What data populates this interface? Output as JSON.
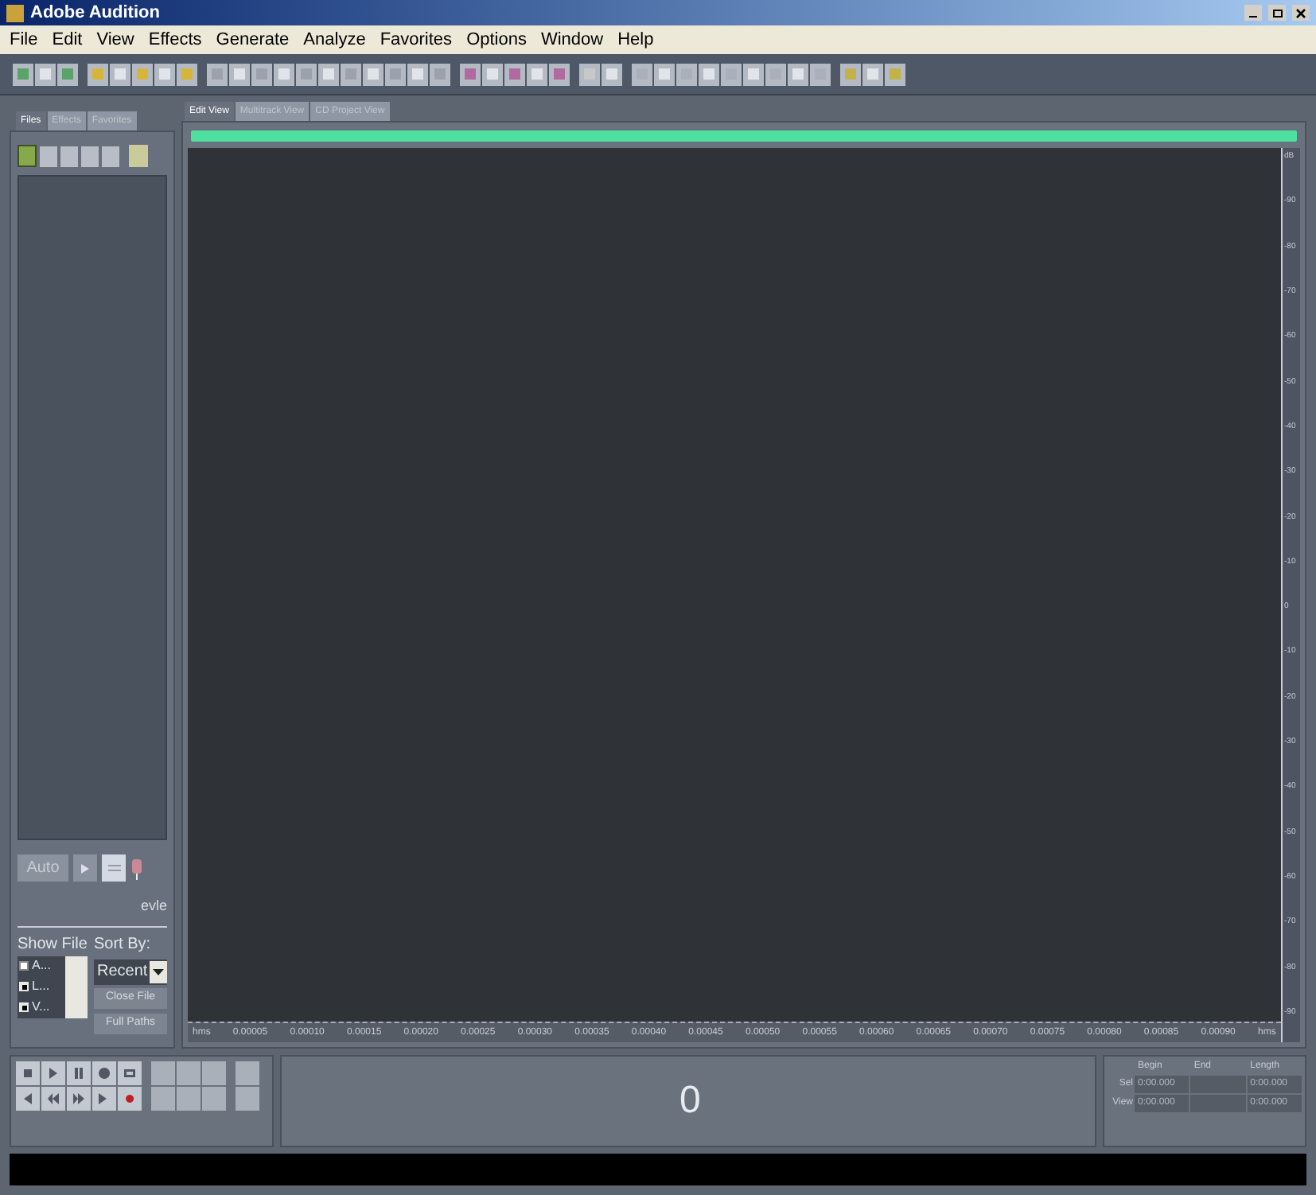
{
  "window": {
    "title": "Adobe Audition"
  },
  "menu": [
    "File",
    "Edit",
    "View",
    "Effects",
    "Generate",
    "Analyze",
    "Favorites",
    "Options",
    "Window",
    "Help"
  ],
  "panel_tabs": [
    {
      "label": "Files",
      "selected": true
    },
    {
      "label": "Effects",
      "selected": false
    },
    {
      "label": "Favorites",
      "selected": false
    }
  ],
  "view_tabs": [
    {
      "label": "Edit View",
      "selected": true
    },
    {
      "label": "Multitrack View",
      "selected": false
    },
    {
      "label": "CD Project View",
      "selected": false
    }
  ],
  "files_panel": {
    "auto_button": "Auto",
    "caption": "evle",
    "show_file_label": "Show File",
    "sort_by_label": "Sort By:",
    "sort_value": "Recent",
    "show_items": [
      {
        "label": "A...",
        "checked": false
      },
      {
        "label": "L...",
        "checked": true
      },
      {
        "label": "V...",
        "checked": true
      }
    ],
    "buttons": [
      {
        "label": "Close File",
        "disabled": true
      },
      {
        "label": "Full Paths",
        "disabled": true
      }
    ]
  },
  "time_ruler": {
    "start": "hms",
    "end": "hms",
    "labels": [
      "0.00005",
      "0.00010",
      "0.00015",
      "0.00020",
      "0.00025",
      "0.00030",
      "0.00035",
      "0.00040",
      "0.00045",
      "0.00050",
      "0.00055",
      "0.00060",
      "0.00065",
      "0.00070",
      "0.00075",
      "0.00080",
      "0.00085",
      "0.00090"
    ]
  },
  "db_ruler": [
    "dB",
    "-90",
    "-80",
    "-70",
    "-60",
    "-50",
    "-40",
    "-30",
    "-20",
    "-10",
    "0",
    "-10",
    "-20",
    "-30",
    "-40",
    "-50",
    "-60",
    "-70",
    "-80",
    "-90"
  ],
  "time_display": "0",
  "selection": {
    "columns": [
      "Begin",
      "End",
      "Length"
    ],
    "rows": [
      {
        "label": "Sel",
        "begin": "0:00.000",
        "length": "0:00.000"
      },
      {
        "label": "View",
        "begin": "0:00.000",
        "length": "0:00.000"
      }
    ]
  }
}
